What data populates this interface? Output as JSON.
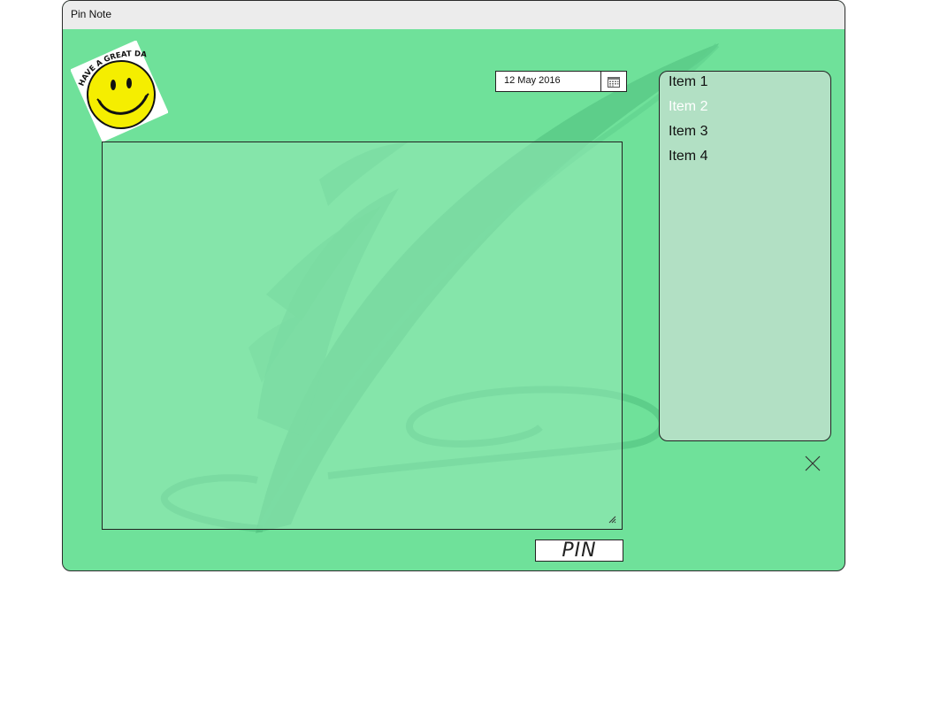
{
  "window": {
    "title": "Pin Note"
  },
  "sticker": {
    "text": "HAVE A GREAT DAY!"
  },
  "date_picker": {
    "value": "12 May 2016",
    "icon": "calendar-icon"
  },
  "note": {
    "value": ""
  },
  "pin_button": {
    "label": "PIN"
  },
  "list": {
    "items": [
      {
        "label": "Item 1",
        "selected": false
      },
      {
        "label": "Item 2",
        "selected": true
      },
      {
        "label": "Item 3",
        "selected": false
      },
      {
        "label": "Item 4",
        "selected": false
      }
    ]
  },
  "close_button": {
    "icon": "close-icon"
  },
  "colors": {
    "window_bg": "#6fe19a",
    "titlebar_bg": "#ececec",
    "list_bg": "#b2e0c4",
    "selected_text": "#ffffff",
    "feather": "#4fbf7e"
  }
}
